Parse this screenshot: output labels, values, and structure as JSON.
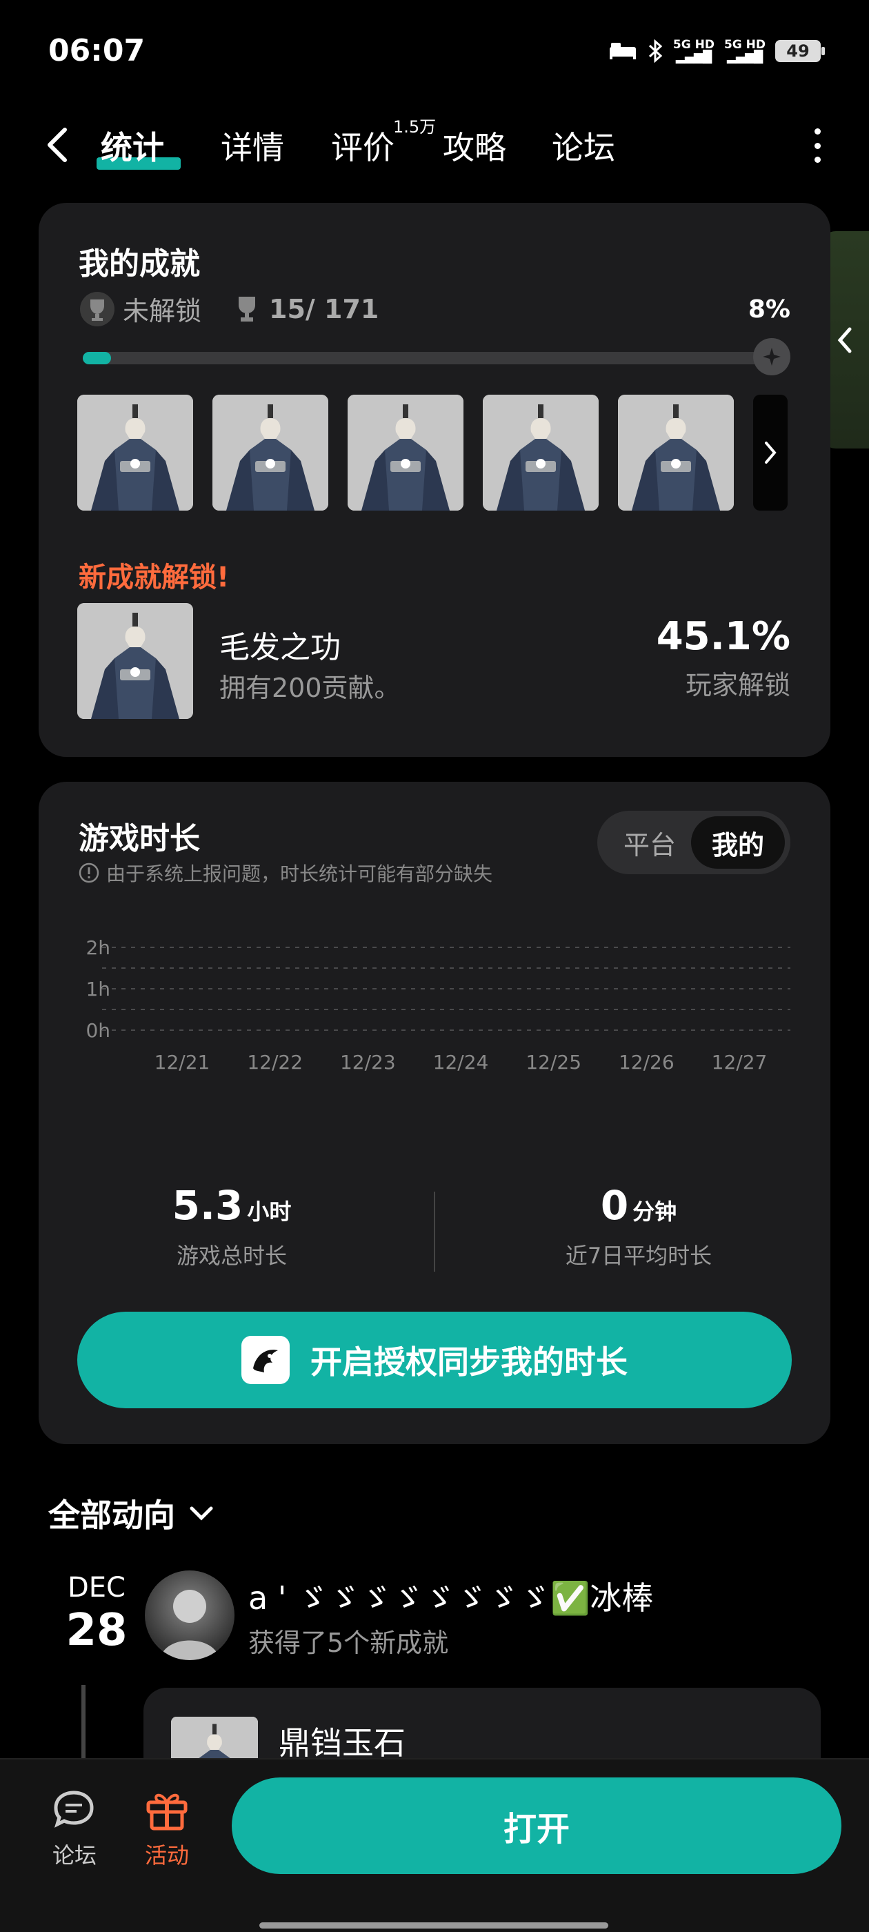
{
  "status": {
    "time": "06:07",
    "signal1": "5G HD",
    "signal2": "5G HD",
    "battery": "49"
  },
  "tabs": [
    {
      "label": "统计"
    },
    {
      "label": "详情"
    },
    {
      "label": "评价"
    },
    {
      "label": "攻略"
    },
    {
      "label": "论坛"
    }
  ],
  "review_badge": "1.5万",
  "achievements": {
    "title": "我的成就",
    "locked_label": "未解锁",
    "count": "15/ 171",
    "percent": "8%",
    "progress": 0.08,
    "new_unlock_label": "新成就解锁!",
    "new_item": {
      "name": "毛发之功",
      "desc": "拥有200贡献。",
      "rate": "45.1%",
      "rate_label": "玩家解锁"
    }
  },
  "playtime": {
    "title": "游戏时长",
    "note": "由于系统上报问题，时长统计可能有部分缺失",
    "toggle_platform": "平台",
    "toggle_mine": "我的",
    "total_value": "5.3",
    "total_unit": "小时",
    "total_label": "游戏总时长",
    "avg_value": "0",
    "avg_unit": "分钟",
    "avg_label": "近7日平均时长",
    "sync_button": "开启授权同步我的时长"
  },
  "chart_data": {
    "type": "line",
    "categories": [
      "12/21",
      "12/22",
      "12/23",
      "12/24",
      "12/25",
      "12/26",
      "12/27"
    ],
    "series": [
      {
        "values": [
          0,
          0,
          0,
          0,
          0,
          0,
          0
        ]
      }
    ],
    "yticks": [
      "2h",
      "1h",
      "0h"
    ],
    "ylim": [
      0,
      2
    ],
    "grid": true
  },
  "feed": {
    "header": "全部动向",
    "month": "DEC",
    "day": "28",
    "user": "a ' ゞゞゞゞゞゞゞゞ✅冰棒",
    "sub": "获得了5个新成就",
    "card_title": "鼎铛玉石"
  },
  "bottom": {
    "forum_label": "论坛",
    "activity_label": "活动",
    "open_label": "打开"
  },
  "colors": {
    "accent": "#12b3a4",
    "highlight": "#ff6b3d"
  }
}
